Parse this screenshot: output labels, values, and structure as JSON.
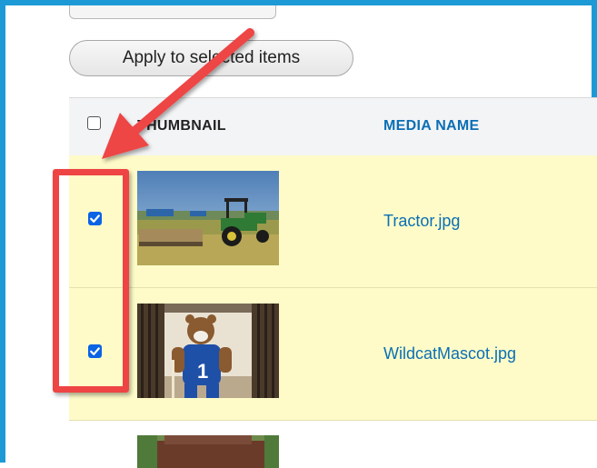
{
  "toolbar": {
    "apply_label": "Apply to selected items"
  },
  "table": {
    "columns": {
      "thumbnail": "THUMBNAIL",
      "media_name": "MEDIA NAME"
    },
    "rows": [
      {
        "name": "Tractor.jpg",
        "selected": true
      },
      {
        "name": "WildcatMascot.jpg",
        "selected": true
      },
      {
        "name": "",
        "selected": false
      }
    ]
  },
  "colors": {
    "frame": "#1d9ad6",
    "selected_row": "#fefbc8",
    "link": "#0b6fb5",
    "checkbox": "#0b63e5",
    "annotation": "#ee4444"
  },
  "icons": {
    "checkbox_checked": "check-icon",
    "annotation_arrow": "red-arrow-icon"
  }
}
